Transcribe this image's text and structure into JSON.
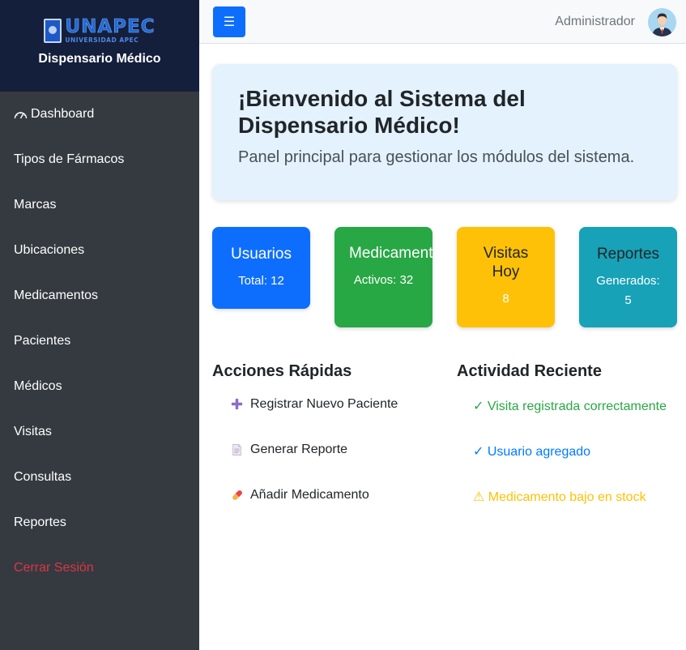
{
  "sidebar": {
    "logo_main": "UNAPEC",
    "logo_sub": "UNIVERSIDAD APEC",
    "title": "Dispensario Médico",
    "items": [
      {
        "label": "Dashboard",
        "icon": "gauge-icon"
      },
      {
        "label": "Tipos de Fármacos"
      },
      {
        "label": "Marcas"
      },
      {
        "label": "Ubicaciones"
      },
      {
        "label": "Medicamentos"
      },
      {
        "label": "Pacientes"
      },
      {
        "label": "Médicos"
      },
      {
        "label": "Visitas"
      },
      {
        "label": "Consultas"
      },
      {
        "label": "Reportes"
      },
      {
        "label": "Cerrar Sesión"
      }
    ]
  },
  "topbar": {
    "menu_icon": "☰",
    "user_name": "Administrador",
    "avatar_icon": "user-avatar-icon"
  },
  "welcome": {
    "title": "¡Bienvenido al Sistema del Dispensario Médico!",
    "subtitle": "Panel principal para gestionar los módulos del sistema."
  },
  "cards": [
    {
      "title": "Usuarios",
      "value": "Total: 12",
      "color": "#0d6efd"
    },
    {
      "title": "Medicamentos",
      "value": "Activos: 32",
      "color": "#28a745"
    },
    {
      "title": "Visitas Hoy",
      "value": "8",
      "color": "#ffc107"
    },
    {
      "title": "Reportes",
      "value": "Generados: 5",
      "color": "#17a2b8"
    }
  ],
  "quick_actions": {
    "title": "Acciones Rápidas",
    "items": [
      {
        "label": "Registrar Nuevo Paciente",
        "icon": "plus-icon"
      },
      {
        "label": "Generar Reporte",
        "icon": "document-icon"
      },
      {
        "label": "Añadir Medicamento",
        "icon": "pill-icon"
      }
    ]
  },
  "recent_activity": {
    "title": "Actividad Reciente",
    "items": [
      {
        "text": "✓ Visita registrada correctamente",
        "color": "#28a745"
      },
      {
        "text": "✓ Usuario agregado",
        "color": "#007bff"
      },
      {
        "text": "⚠ Medicamento bajo en stock",
        "color": "#ffc107"
      }
    ]
  }
}
